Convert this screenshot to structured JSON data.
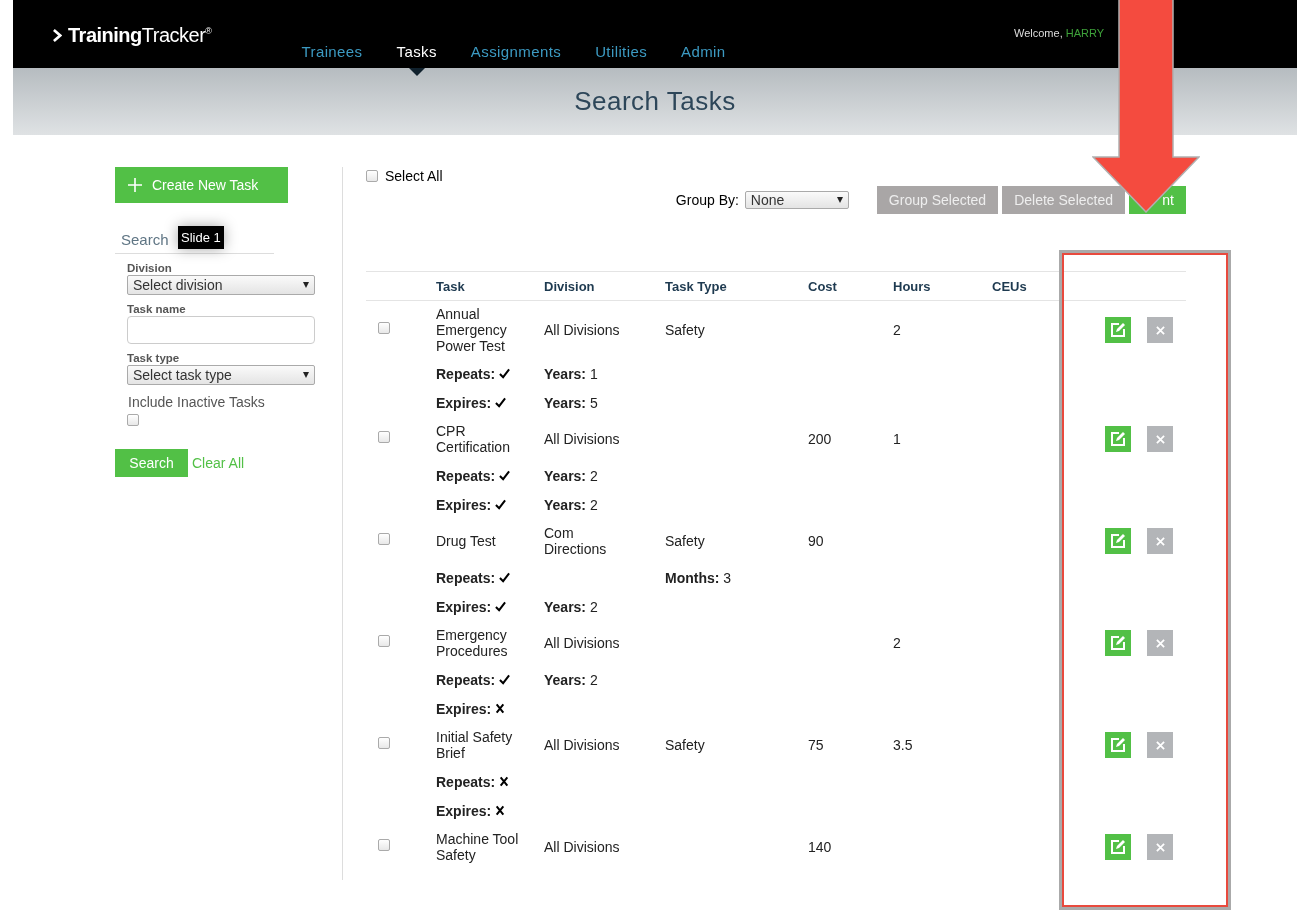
{
  "header": {
    "logo_bold": "Training",
    "logo_light": "Tracker",
    "logo_mark": "®",
    "welcome": "Welcome,",
    "user": "HARRY"
  },
  "nav": [
    {
      "label": "Trainees",
      "selected": false
    },
    {
      "label": "Tasks",
      "selected": true
    },
    {
      "label": "Assignments",
      "selected": false
    },
    {
      "label": "Utilities",
      "selected": false
    },
    {
      "label": "Admin",
      "selected": false
    }
  ],
  "page_title": "Search Tasks",
  "sidebar": {
    "create_button": "Create New Task",
    "search_tab": "Search",
    "tooltip": "Slide 1",
    "fields": [
      {
        "kind": "select",
        "label": "Division",
        "value": "Select division"
      },
      {
        "kind": "text",
        "label": "Task name"
      },
      {
        "kind": "select",
        "label": "Task type",
        "value": "Select task type"
      }
    ],
    "include_inactive": {
      "label": "Include Inactive Tasks",
      "checked": false
    },
    "search_button": "Search",
    "clear_link": "Clear All"
  },
  "toolbar": {
    "select_all": {
      "label": "Select All",
      "checked": false
    },
    "group_by_label": "Group By:",
    "group_by_value": "None",
    "buttons": [
      {
        "label": "Group Selected",
        "disabled": true
      },
      {
        "label": "Delete Selected",
        "disabled": true
      },
      {
        "label": "nt",
        "disabled": false
      }
    ]
  },
  "table": {
    "columns": [
      "Task",
      "Division",
      "Task Type",
      "Cost",
      "Hours",
      "CEUs"
    ],
    "rows": [
      {
        "checked": false,
        "task": "Annual Emergency Power Test",
        "division": "All Divisions",
        "task_type": "Safety",
        "hours": "2",
        "details": [
          {
            "label": "Repeats:",
            "on": true,
            "division": "**Years:** 1"
          },
          {
            "label": "Expires:",
            "on": true,
            "division": "**Years:** 5"
          }
        ]
      },
      {
        "checked": false,
        "task": "CPR Certification",
        "division": "All Divisions",
        "cost": "200",
        "hours": "1",
        "details": [
          {
            "label": "Repeats:",
            "on": true,
            "division": "**Years:** 2"
          },
          {
            "label": "Expires:",
            "on": true,
            "division": "**Years:** 2"
          }
        ]
      },
      {
        "checked": false,
        "task": "Drug Test",
        "division": "Com Directions",
        "task_type": "Safety",
        "cost": "90",
        "details": [
          {
            "label": "Repeats:",
            "on": true,
            "task_type": "**Months:** 3"
          },
          {
            "label": "Expires:",
            "on": true,
            "division": "**Years:** 2"
          }
        ]
      },
      {
        "checked": false,
        "task": "Emergency Procedures",
        "division": "All Divisions",
        "hours": "2",
        "details": [
          {
            "label": "Repeats:",
            "on": true,
            "division": "**Years:** 2"
          },
          {
            "label": "Expires:",
            "on": false
          }
        ]
      },
      {
        "checked": false,
        "task": "Initial Safety Brief",
        "division": "All Divisions",
        "task_type": "Safety",
        "cost": "75",
        "hours": "3.5",
        "details": [
          {
            "label": "Repeats:",
            "on": false
          },
          {
            "label": "Expires:",
            "on": false
          }
        ]
      },
      {
        "checked": false,
        "task": "Machine Tool Safety",
        "division": "All Divisions",
        "cost": "140",
        "details": []
      }
    ]
  }
}
